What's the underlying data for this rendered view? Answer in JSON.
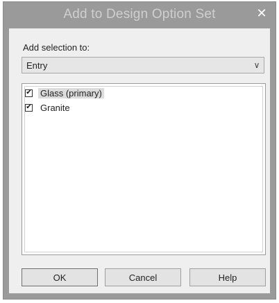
{
  "dialog": {
    "title": "Add to Design Option Set",
    "close_glyph": "✕"
  },
  "form": {
    "add_selection_label": "Add selection to:",
    "option_set_value": "Entry",
    "chevron_glyph": "∨"
  },
  "options": [
    {
      "label": "Glass (primary)",
      "checked": true,
      "selected": true
    },
    {
      "label": "Granite",
      "checked": true,
      "selected": false
    }
  ],
  "buttons": {
    "ok": "OK",
    "cancel": "Cancel",
    "help": "Help"
  }
}
